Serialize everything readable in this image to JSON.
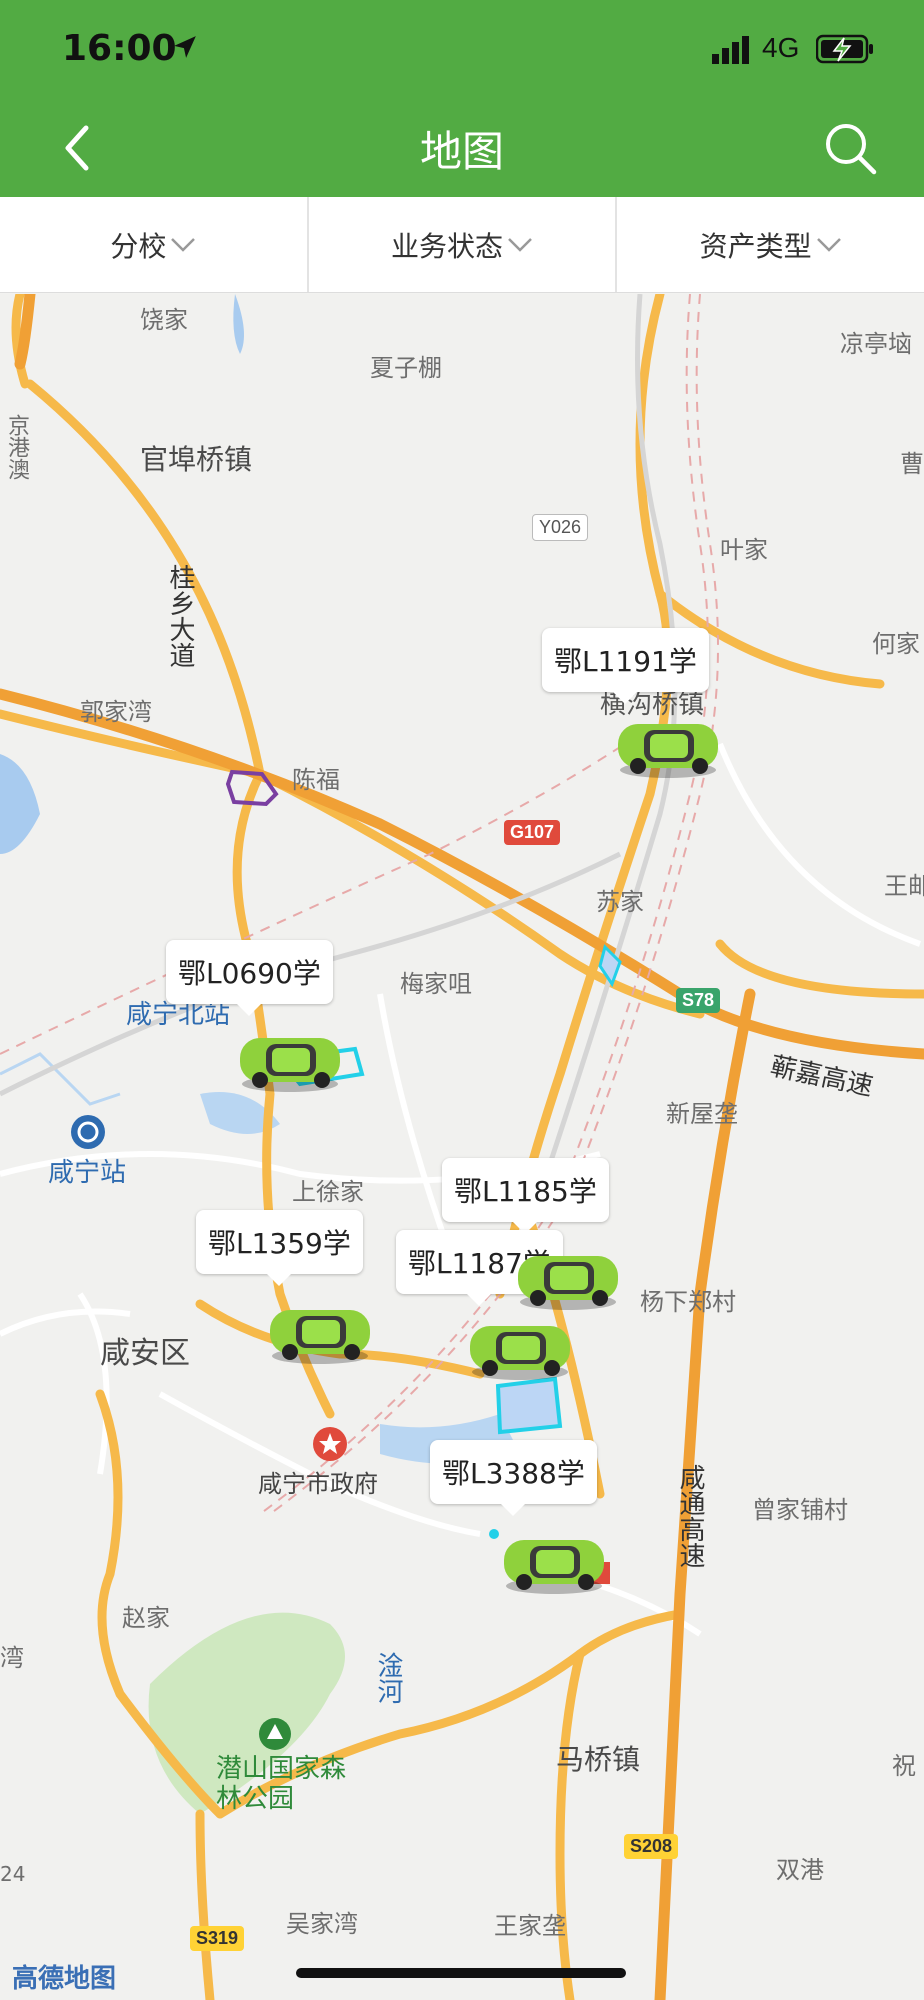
{
  "status_bar": {
    "time": "16:00",
    "network": "4G"
  },
  "header": {
    "title": "地图"
  },
  "filters": [
    {
      "label": "分校"
    },
    {
      "label": "业务状态"
    },
    {
      "label": "资产类型"
    }
  ],
  "map": {
    "place_labels": {
      "raojia": "饶家",
      "xiazipeng": "夏子棚",
      "liangting": "凉亭垴",
      "guanfuqiao": "官埠桥镇",
      "cao": "曹",
      "jinggang": "京港澳",
      "guixiang": "桂乡大道",
      "yejia": "叶家",
      "hejia": "何家",
      "guojiawan": "郭家湾",
      "chenfu": "陈福",
      "hengkouqiao": "横沟桥镇",
      "wangjia_right": "王邮",
      "sujia": "苏家",
      "meijiaju": "梅家咀",
      "xianningbei": "咸宁北站",
      "qijia": "蕲嘉高速",
      "xinwulong": "新屋垄",
      "xianningzhan": "咸宁站",
      "shangxujia": "上徐家",
      "yangxiazheng": "杨下郑村",
      "xiananqu": "咸安区",
      "zhengfu": "咸宁市政府",
      "xiantong": "咸通高速",
      "zengjiapu": "曾家铺村",
      "zhaojia": "赵家",
      "wan": "湾",
      "tuhe": "淦河",
      "qianshan": "潜山国家森林公园",
      "maqiao": "马桥镇",
      "zhu": "祝",
      "shuanggang": "双港",
      "wujiawan": "吴家湾",
      "wangjiawu": "王家垄",
      "num24": "24"
    },
    "shields": {
      "y026": "Y026",
      "g107": "G107",
      "s78": "S78",
      "s208": "S208",
      "s319": "S319"
    },
    "vehicles": [
      {
        "plate": "鄂L1191学"
      },
      {
        "plate": "鄂L0690学"
      },
      {
        "plate": "鄂L1185学"
      },
      {
        "plate": "鄂L1359学"
      },
      {
        "plate": "鄂L1187学"
      },
      {
        "plate": "鄂L3388学"
      }
    ],
    "logo": "高德地图"
  },
  "colors": {
    "header": "#52ab43",
    "car": "#8fd13c",
    "road": "#f6b94a"
  }
}
